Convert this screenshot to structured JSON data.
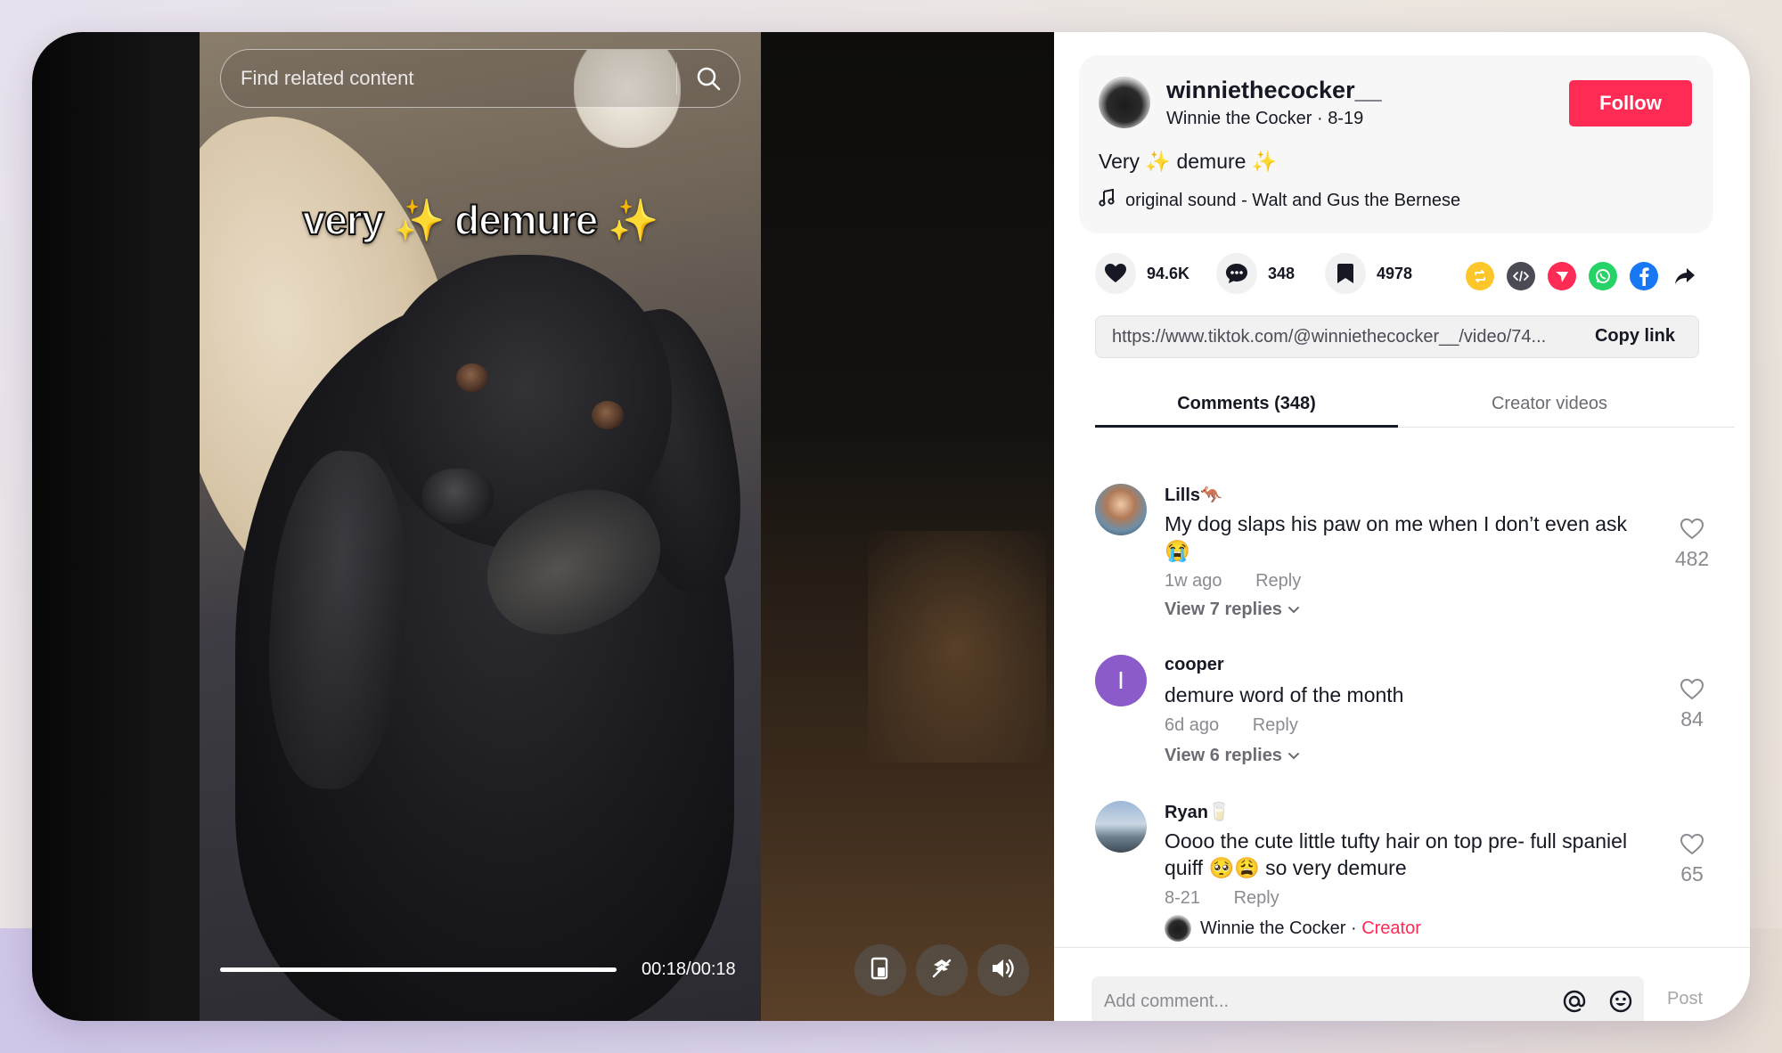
{
  "search": {
    "placeholder": "Find related content"
  },
  "video": {
    "caption_word1": "very",
    "caption_spark": "✨",
    "caption_word2": "demure",
    "time": "00:18/00:18",
    "progress": 1.0
  },
  "post": {
    "username": "winniethecocker__",
    "nickname": "Winnie the Cocker",
    "date": "8-19",
    "follow_label": "Follow",
    "description_word1": "Very",
    "description_spark": "✨",
    "description_word2": "demure",
    "music": "original sound - Walt and Gus the Bernese"
  },
  "actions": {
    "likes": "94.6K",
    "comments": "348",
    "saves": "4978",
    "share_icons": [
      "repost-icon",
      "embed-icon",
      "send-icon",
      "whatsapp-icon",
      "facebook-icon",
      "share-arrow-icon"
    ]
  },
  "link": {
    "url": "https://www.tiktok.com/@winniethecocker__/video/74...",
    "copy_label": "Copy link"
  },
  "tabs": [
    "Comments (348)",
    "Creator videos"
  ],
  "comments": [
    {
      "user": "Lills",
      "user_emoji": "🦘",
      "text": "My dog slaps his paw on me when I don’t even ask",
      "text_emoji": "😭",
      "time": "1w ago",
      "reply_label": "Reply",
      "view_replies": "View 7 replies",
      "likes": "482"
    },
    {
      "user": "cooper",
      "avatar_letter": "I",
      "text": "demure word of the month",
      "time": "6d ago",
      "reply_label": "Reply",
      "view_replies": "View 6 replies",
      "likes": "84"
    },
    {
      "user": "Ryan",
      "user_emoji": "🥛",
      "text": "Oooo the cute little tufty hair on top pre- full spaniel quiff 🥺😩 so very demure",
      "time": "8-21",
      "reply_label": "Reply",
      "likes": "65",
      "creator_reply_name": "Winnie the Cocker",
      "creator_reply_sep": " · ",
      "creator_tag": "Creator"
    }
  ],
  "composer": {
    "placeholder": "Add comment...",
    "post_label": "Post"
  },
  "colors": {
    "accent": "#fe2c55",
    "text": "#161823",
    "muted": "#8a8b91",
    "cooper_avatar": "#8b5cc9"
  }
}
